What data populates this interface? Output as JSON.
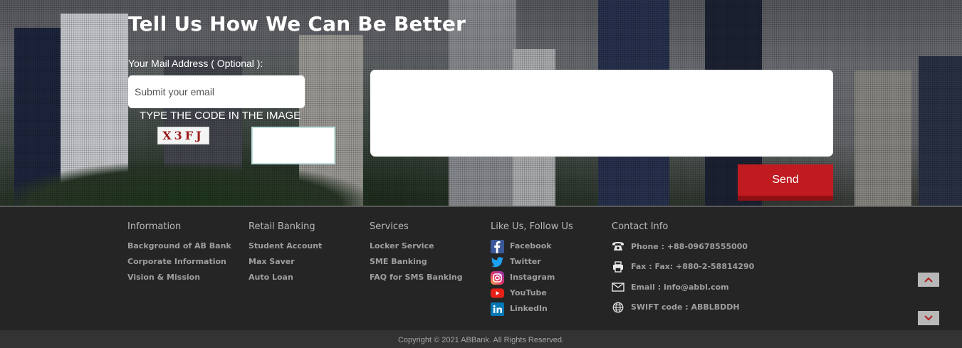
{
  "feedback": {
    "title": "Tell Us How We Can Be Better",
    "mail_label": "Your Mail Address ( Optional ):",
    "email_placeholder": "Submit your email",
    "code_label": "TYPE THE CODE IN THE IMAGE",
    "captcha_text": "X3FJ",
    "send_label": "Send"
  },
  "footer": {
    "information": {
      "heading": "Information",
      "links": [
        "Background of AB Bank",
        "Corporate Information",
        "Vision & Mission"
      ]
    },
    "retail": {
      "heading": "Retail Banking",
      "links": [
        "Student Account",
        "Max Saver",
        "Auto Loan"
      ]
    },
    "services": {
      "heading": "Services",
      "links": [
        "Locker Service",
        "SME Banking",
        "FAQ for SMS Banking"
      ]
    },
    "social": {
      "heading": "Like Us, Follow Us",
      "items": [
        {
          "label": "Facebook",
          "icon": "facebook-icon",
          "color": "#3b5998"
        },
        {
          "label": "Twitter",
          "icon": "twitter-icon",
          "color": "#1da1f2"
        },
        {
          "label": "Instagram",
          "icon": "instagram-icon",
          "color": "#c13584"
        },
        {
          "label": "YouTube",
          "icon": "youtube-icon",
          "color": "#e62117"
        },
        {
          "label": "LinkedIn",
          "icon": "linkedin-icon",
          "color": "#0077b5"
        }
      ]
    },
    "contact": {
      "heading": "Contact Info",
      "phone": "Phone : +88-09678555000",
      "fax": "Fax : Fax: +880-2-58814290",
      "email": "Email : info@abbl.com",
      "swift": "SWIFT code : ABBLBDDH"
    },
    "copyright": "Copyright © 2021 ABBank. All Rights Reserved."
  },
  "colors": {
    "accent": "#bf1b20",
    "footer_bg": "#252525"
  }
}
